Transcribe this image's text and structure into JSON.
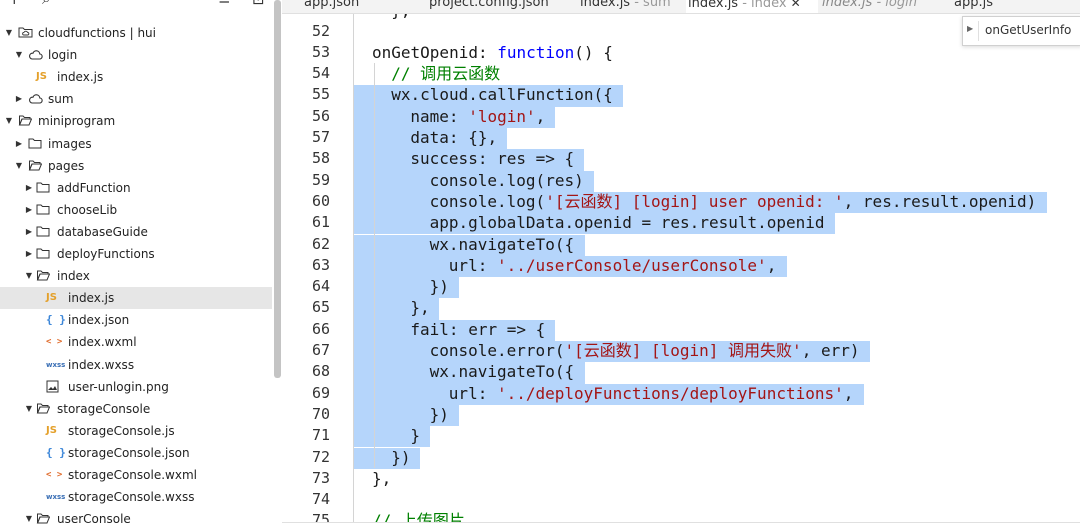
{
  "toolbar": {
    "add_icon": "+",
    "search_icon": "⌕",
    "collapse_icon": "≡",
    "split_icon": "⊡"
  },
  "tabs": [
    {
      "name": "app.json",
      "sub": ""
    },
    {
      "name": "project.config.json",
      "sub": ""
    },
    {
      "name": "index.js",
      "sub": " - sum"
    },
    {
      "name": "index.js",
      "sub": " - index",
      "close": "✕"
    },
    {
      "name": "index.js",
      "sub": " - login"
    },
    {
      "name": "app.js",
      "sub": ""
    }
  ],
  "tree": [
    {
      "label": "cloudfunctions | hui",
      "icon": "cloud-folder",
      "arrow": "open",
      "indent": 0
    },
    {
      "label": "login",
      "icon": "cloud",
      "arrow": "open",
      "indent": 1
    },
    {
      "label": "index.js",
      "icon": "js",
      "arrow": "",
      "indent": 2
    },
    {
      "label": "sum",
      "icon": "cloud",
      "arrow": "closed",
      "indent": 1
    },
    {
      "label": "miniprogram",
      "icon": "folder-open",
      "arrow": "open",
      "indent": 0
    },
    {
      "label": "images",
      "icon": "folder",
      "arrow": "closed",
      "indent": 1
    },
    {
      "label": "pages",
      "icon": "folder-open",
      "arrow": "open",
      "indent": 1
    },
    {
      "label": "addFunction",
      "icon": "folder",
      "arrow": "closed",
      "indent": 2
    },
    {
      "label": "chooseLib",
      "icon": "folder",
      "arrow": "closed",
      "indent": 2
    },
    {
      "label": "databaseGuide",
      "icon": "folder",
      "arrow": "closed",
      "indent": 2
    },
    {
      "label": "deployFunctions",
      "icon": "folder",
      "arrow": "closed",
      "indent": 2
    },
    {
      "label": "index",
      "icon": "folder-open",
      "arrow": "open",
      "indent": 2
    },
    {
      "label": "index.js",
      "icon": "js",
      "arrow": "",
      "indent": 3,
      "selected": true
    },
    {
      "label": "index.json",
      "icon": "json",
      "arrow": "",
      "indent": 3
    },
    {
      "label": "index.wxml",
      "icon": "wxml",
      "arrow": "",
      "indent": 3
    },
    {
      "label": "index.wxss",
      "icon": "wxss",
      "arrow": "",
      "indent": 3
    },
    {
      "label": "user-unlogin.png",
      "icon": "image",
      "arrow": "",
      "indent": 3
    },
    {
      "label": "storageConsole",
      "icon": "folder-open",
      "arrow": "open",
      "indent": 2
    },
    {
      "label": "storageConsole.js",
      "icon": "js",
      "arrow": "",
      "indent": 3
    },
    {
      "label": "storageConsole.json",
      "icon": "json",
      "arrow": "",
      "indent": 3
    },
    {
      "label": "storageConsole.wxml",
      "icon": "wxml",
      "arrow": "",
      "indent": 3
    },
    {
      "label": "storageConsole.wxss",
      "icon": "wxss",
      "arrow": "",
      "indent": 3
    },
    {
      "label": "userConsole",
      "icon": "folder-open",
      "arrow": "open",
      "indent": 2
    }
  ],
  "badges": {
    "js": "JS",
    "json": "{ }",
    "wxml": "< >",
    "wxss": "wxss"
  },
  "popup": {
    "text": "onGetUserInfo"
  },
  "code": {
    "top_fragment": "  },",
    "lines": [
      {
        "n": "52",
        "indent": 0,
        "tokens": [],
        "sel": null
      },
      {
        "n": "53",
        "indent": 1,
        "tokens": [
          [
            "",
            "onGetOpenid: "
          ],
          [
            "kw",
            "function"
          ],
          [
            "",
            "() {"
          ]
        ],
        "sel": null
      },
      {
        "n": "54",
        "indent": 2,
        "tokens": [
          [
            "cmt",
            "// 调用云函数"
          ]
        ],
        "sel": null
      },
      {
        "n": "55",
        "indent": 2,
        "tokens": [
          [
            "",
            "wx.cloud.callFunction({"
          ]
        ],
        "sel": [
          0,
          27
        ]
      },
      {
        "n": "56",
        "indent": 3,
        "tokens": [
          [
            "",
            "name: "
          ],
          [
            "str",
            "'login'"
          ],
          [
            "",
            ","
          ]
        ],
        "sel": [
          0,
          21
        ]
      },
      {
        "n": "57",
        "indent": 3,
        "tokens": [
          [
            "",
            "data: {},"
          ]
        ],
        "sel": [
          0,
          18
        ]
      },
      {
        "n": "58",
        "indent": 3,
        "tokens": [
          [
            "",
            "success: res => {"
          ]
        ],
        "sel": [
          0,
          26
        ]
      },
      {
        "n": "59",
        "indent": 4,
        "tokens": [
          [
            "",
            "console.log(res)"
          ]
        ],
        "sel": [
          0,
          26
        ]
      },
      {
        "n": "60",
        "indent": 4,
        "tokens": [
          [
            "",
            "console.log("
          ],
          [
            "str",
            "'[云函数] [login] user openid: '"
          ],
          [
            "",
            ", res.result.openid)"
          ]
        ],
        "sel": [
          0,
          72
        ]
      },
      {
        "n": "61",
        "indent": 4,
        "tokens": [
          [
            "",
            "app.globalData.openid = res.result.openid"
          ]
        ],
        "sel": [
          0,
          51
        ]
      },
      {
        "n": "62",
        "indent": 4,
        "tokens": [
          [
            "",
            "wx.navigateTo({"
          ]
        ],
        "sel": [
          0,
          25
        ]
      },
      {
        "n": "63",
        "indent": 5,
        "tokens": [
          [
            "",
            "url: "
          ],
          [
            "str",
            "'../userConsole/userConsole'"
          ],
          [
            "",
            ","
          ]
        ],
        "sel": [
          0,
          45
        ]
      },
      {
        "n": "64",
        "indent": 4,
        "tokens": [
          [
            "",
            "})"
          ]
        ],
        "sel": [
          0,
          12
        ]
      },
      {
        "n": "65",
        "indent": 3,
        "tokens": [
          [
            "",
            "},"
          ]
        ],
        "sel": [
          0,
          10
        ]
      },
      {
        "n": "66",
        "indent": 3,
        "tokens": [
          [
            "",
            "fail: err => {"
          ]
        ],
        "sel": [
          0,
          23
        ]
      },
      {
        "n": "67",
        "indent": 4,
        "tokens": [
          [
            "",
            "console.error("
          ],
          [
            "str",
            "'[云函数] [login] 调用失败'"
          ],
          [
            "",
            ", err)"
          ]
        ],
        "sel": [
          0,
          52
        ]
      },
      {
        "n": "68",
        "indent": 4,
        "tokens": [
          [
            "",
            "wx.navigateTo({"
          ]
        ],
        "sel": [
          0,
          25
        ]
      },
      {
        "n": "69",
        "indent": 5,
        "tokens": [
          [
            "",
            "url: "
          ],
          [
            "str",
            "'../deployFunctions/deployFunctions'"
          ],
          [
            "",
            ","
          ]
        ],
        "sel": [
          0,
          53
        ]
      },
      {
        "n": "70",
        "indent": 4,
        "tokens": [
          [
            "",
            "})"
          ]
        ],
        "sel": [
          0,
          12
        ]
      },
      {
        "n": "71",
        "indent": 3,
        "tokens": [
          [
            "",
            "}"
          ]
        ],
        "sel": [
          0,
          9
        ]
      },
      {
        "n": "72",
        "indent": 2,
        "tokens": [
          [
            "",
            "})"
          ]
        ],
        "sel": [
          0,
          6
        ]
      },
      {
        "n": "73",
        "indent": 1,
        "tokens": [
          [
            "",
            "},"
          ]
        ],
        "sel": null
      },
      {
        "n": "74",
        "indent": 0,
        "tokens": [],
        "sel": null
      },
      {
        "n": "75",
        "indent": 1,
        "tokens": [
          [
            "cmt",
            "// 上传图片"
          ]
        ],
        "sel": null
      }
    ]
  }
}
